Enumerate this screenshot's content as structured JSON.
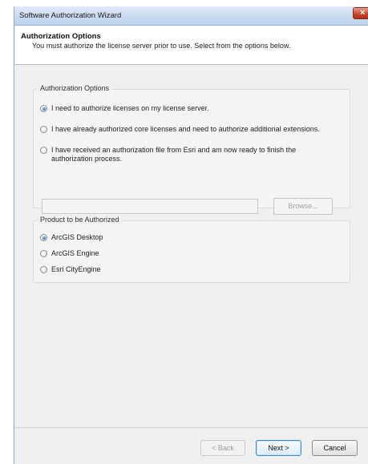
{
  "window": {
    "title": "Software Authorization Wizard",
    "close_glyph": "×"
  },
  "header": {
    "title": "Authorization Options",
    "subtitle": "You must authorize the license server prior to use. Select from the options below."
  },
  "auth_options": {
    "legend": "Authorization Options",
    "options": [
      {
        "label": "I need to authorize licenses on my license server.",
        "checked": true
      },
      {
        "label": "I have already authorized core licenses and need to authorize additional extensions.",
        "checked": false
      },
      {
        "label_line1": "I have received an authorization file from Esri and am now ready to finish the",
        "label_line2": "authorization process.",
        "checked": false
      }
    ],
    "path_value": "",
    "browse_label": "Browse..."
  },
  "product": {
    "legend": "Product to be Authorized",
    "options": [
      {
        "label": "ArcGIS Desktop",
        "checked": true
      },
      {
        "label": "ArcGIS Engine",
        "checked": false
      },
      {
        "label": "Esri CityEngine",
        "checked": false
      }
    ]
  },
  "footer": {
    "back_label": "< Back",
    "next_label": "Next >",
    "cancel_label": "Cancel"
  }
}
